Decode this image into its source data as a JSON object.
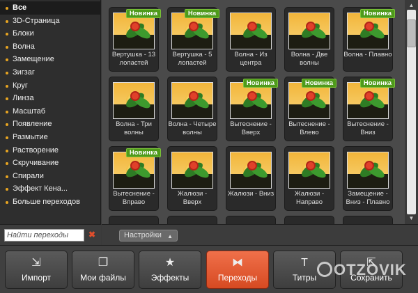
{
  "sidebar": {
    "categories": [
      {
        "label": "Все",
        "selected": true
      },
      {
        "label": "3D-Страница"
      },
      {
        "label": "Блоки"
      },
      {
        "label": "Волна"
      },
      {
        "label": "Замещение"
      },
      {
        "label": "Зигзаг"
      },
      {
        "label": "Круг"
      },
      {
        "label": "Линза"
      },
      {
        "label": "Масштаб"
      },
      {
        "label": "Появление"
      },
      {
        "label": "Размытие"
      },
      {
        "label": "Растворение"
      },
      {
        "label": "Скручивание"
      },
      {
        "label": "Спирали"
      },
      {
        "label": "Эффект Кена..."
      },
      {
        "label": "Больше переходов"
      }
    ],
    "bullet_color": "#e8a521"
  },
  "search": {
    "placeholder": "Найти переходы",
    "clear_icon": "close-icon"
  },
  "badge_label": "Новинка",
  "transitions": [
    {
      "caption": "Вертушка - 13 лопастей",
      "new": true
    },
    {
      "caption": "Вертушка - 5 лопастей",
      "new": true
    },
    {
      "caption": "Волна - Из центра",
      "new": false
    },
    {
      "caption": "Волна - Две волны",
      "new": false
    },
    {
      "caption": "Волна - Плавно",
      "new": true
    },
    {
      "caption": "Волна - Три волны",
      "new": false
    },
    {
      "caption": "Волна - Четыре волны",
      "new": false
    },
    {
      "caption": "Вытеснение - Вверх",
      "new": true
    },
    {
      "caption": "Вытеснение - Влево",
      "new": true
    },
    {
      "caption": "Вытеснение - Вниз",
      "new": true
    },
    {
      "caption": "Вытеснение - Вправо",
      "new": true
    },
    {
      "caption": "Жалюзи - Вверх",
      "new": false
    },
    {
      "caption": "Жалюзи - Вниз",
      "new": false
    },
    {
      "caption": "Жалюзи - Направо",
      "new": false
    },
    {
      "caption": "Замещение - Вниз - Плавно",
      "new": false
    }
  ],
  "settings": {
    "label": "Настройки"
  },
  "toolbar": {
    "buttons": [
      {
        "label": "Импорт",
        "icon": "import-icon",
        "glyph": "⇲"
      },
      {
        "label": "Мои файлы",
        "icon": "files-icon",
        "glyph": "❐"
      },
      {
        "label": "Эффекты",
        "icon": "star-icon",
        "glyph": "★"
      },
      {
        "label": "Переходы",
        "icon": "transition-icon",
        "glyph": "⧓",
        "active": true
      },
      {
        "label": "Титры",
        "icon": "text-icon",
        "glyph": "T"
      },
      {
        "label": "Сохранить",
        "icon": "export-icon",
        "glyph": "⇱"
      }
    ],
    "accent": "#e55a30"
  },
  "watermark": "OTZOVIK"
}
